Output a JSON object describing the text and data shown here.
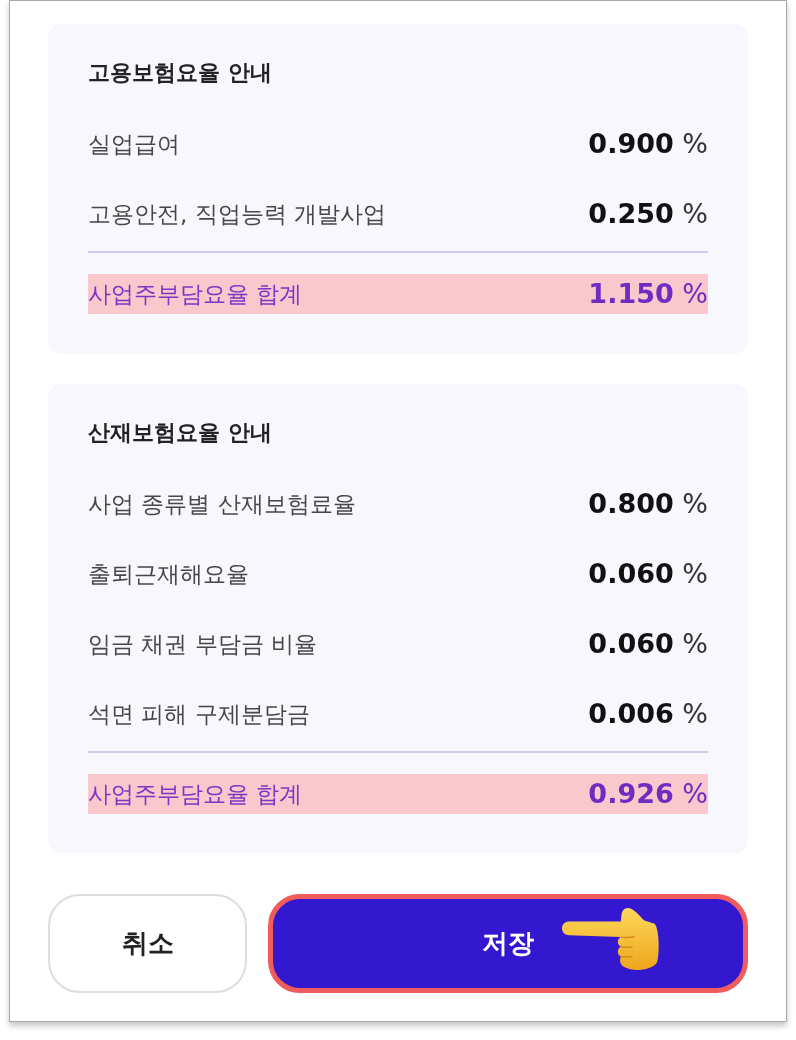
{
  "sections": [
    {
      "title": "고용보험요율 안내",
      "rows": [
        {
          "label": "실업급여",
          "value": "**0.900** %"
        },
        {
          "label": "고용안전, 직업능력 개발사업",
          "value": "**0.250** %"
        }
      ],
      "total": {
        "label": "사업주부담요율 합계",
        "value": "**1.150** %",
        "highlighted": true
      }
    },
    {
      "title": "산재보험요율 안내",
      "rows": [
        {
          "label": "사업 종류별 산재보험료율",
          "value": "**0.800** %"
        },
        {
          "label": "출퇴근재해요율",
          "value": "**0.060** %"
        },
        {
          "label": "임금 채권 부담금 비율",
          "value": "**0.060** %"
        },
        {
          "label": "석면 피해 구제분담금",
          "value": "**0.006** %"
        }
      ],
      "total": {
        "label": "사업주부담요율 합계",
        "value": "**0.926** %",
        "highlighted": true
      }
    }
  ],
  "buttons": [
    {
      "label": "취소",
      "kind": "secondary",
      "highlighted": false
    },
    {
      "label": "저장",
      "kind": "primary",
      "highlighted": true
    }
  ]
}
